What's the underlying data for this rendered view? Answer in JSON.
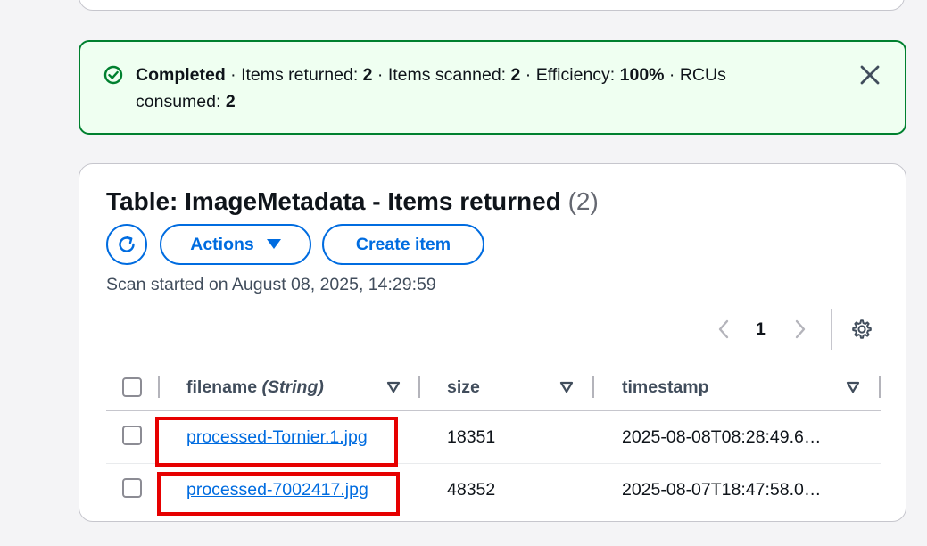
{
  "flash": {
    "status": "Completed",
    "sep1": " · Items returned: ",
    "items_returned": "2",
    "sep2": " · Items scanned: ",
    "items_scanned": "2",
    "sep3": " · Efficiency: ",
    "efficiency": "100%",
    "sep4": " · RCUs consumed: ",
    "rcus_consumed": "2",
    "icon": "success-check-icon",
    "close_icon": "close-icon",
    "color": "#00802f",
    "background": "#effff1"
  },
  "results": {
    "title": "Table: ImageMetadata - Items returned ",
    "count": "(2)",
    "actions_label": "Actions",
    "create_label": "Create item",
    "refresh_icon": "refresh-icon",
    "scan_started": "Scan started on August 08, 2025, 14:29:59",
    "pagination": {
      "current_page": "1",
      "prev_icon": "chevron-left-icon",
      "next_icon": "chevron-right-icon",
      "settings_icon": "gear-icon"
    },
    "columns": [
      {
        "name": "filename",
        "type": "(String)"
      },
      {
        "name": "size"
      },
      {
        "name": "timestamp"
      }
    ],
    "rows": [
      {
        "filename": "processed-Tornier.1.jpg",
        "size": "18351",
        "timestamp": "2025-08-08T08:28:49.6…"
      },
      {
        "filename": "processed-7002417.jpg",
        "size": "48352",
        "timestamp": "2025-08-07T18:47:58.0…"
      }
    ]
  },
  "colors": {
    "accent": "#006ce0",
    "success": "#00802f",
    "highlight": "#e60000"
  }
}
